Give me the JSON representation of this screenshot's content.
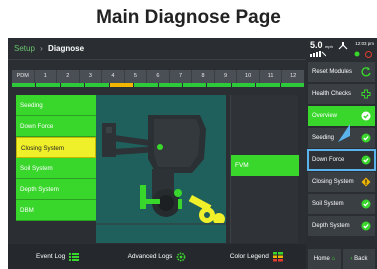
{
  "heading": "Main Diagnose Page",
  "breadcrumb": {
    "root": "Setup",
    "separator": "›",
    "current": "Diagnose"
  },
  "row_strip": [
    "PDM",
    "1",
    "2",
    "3",
    "4",
    "5",
    "6",
    "7",
    "8",
    "9",
    "10",
    "11",
    "12"
  ],
  "row_status": [
    "ok",
    "ok",
    "ok",
    "ok",
    "warn",
    "ok",
    "ok",
    "ok",
    "ok",
    "ok",
    "ok",
    "ok"
  ],
  "systems": [
    {
      "label": "Seeding",
      "state": "ok"
    },
    {
      "label": "Down Force",
      "state": "ok"
    },
    {
      "label": "Closing System",
      "state": "selected"
    },
    {
      "label": "Soil System",
      "state": "ok"
    },
    {
      "label": "Depth System",
      "state": "ok"
    },
    {
      "label": "DBM",
      "state": "ok"
    }
  ],
  "value_panel": {
    "label": "FVM"
  },
  "bottom_bar": {
    "event_log": "Event Log",
    "advanced_logs": "Advanced Logs",
    "color_legend": "Color Legend"
  },
  "status": {
    "speed": "5.0",
    "speed_unit": "mph",
    "time": "12:03 pm"
  },
  "sidebar": {
    "reset_modules": "Reset Modules",
    "health_checks": "Health Checks",
    "overview": "Overview",
    "seeding": "Seeding",
    "down_force": "Down Force",
    "closing_system": "Closing System",
    "soil_system": "Soil System",
    "depth_system": "Depth System",
    "home": "Home",
    "back": "Back"
  },
  "colors": {
    "ok": "#39d62c",
    "warn": "#f3b600",
    "selected": "#f0f02a",
    "highlight": "#5ab3ea"
  }
}
